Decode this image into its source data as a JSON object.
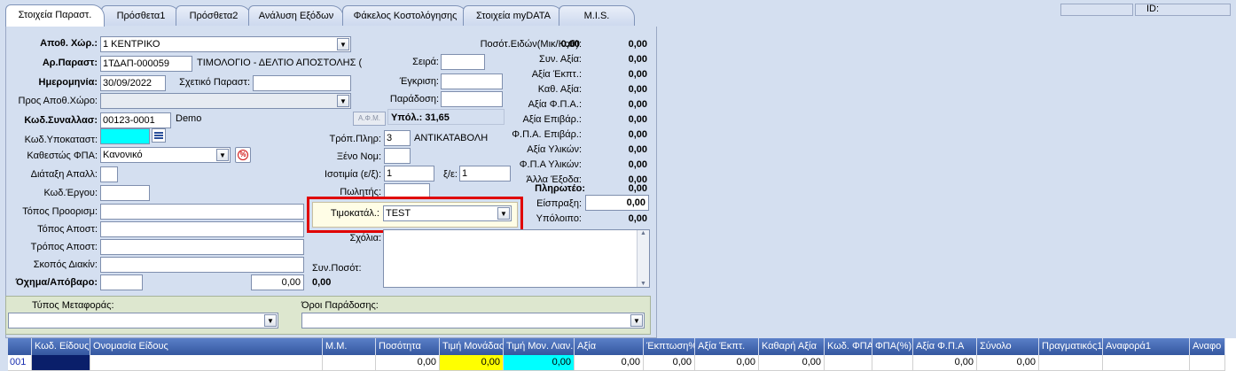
{
  "tabs": [
    "Στοιχεία Παραστ.",
    "Πρόσθετα1",
    "Πρόσθετα2",
    "Ανάλυση Εξόδων",
    "Φάκελος Κοστολόγησης",
    "Στοιχεία myDATA",
    "M.I.S."
  ],
  "top_id_label": "ID:",
  "form": {
    "warehouse_label": "Αποθ. Χώρ.:",
    "warehouse_value": "1 ΚΕΝΤΡΙΚΟ",
    "doc_no_label": "Αρ.Παραστ:",
    "doc_no_value": "1ΤΔΑΠ-000059",
    "doc_type_text": "ΤΙΜΟΛΟΓΙΟ - ΔΕΛΤΙΟ ΑΠΟΣΤΟΛΗΣ (ΕΠ. ΠΙΣΤΩ",
    "date_label": "Ημερομηνία:",
    "date_value": "30/09/2022",
    "related_doc_label": "Σχετικό Παραστ:",
    "to_warehouse_label": "Προς Αποθ.Χώρο:",
    "trader_code_label": "Κωδ.Συναλλασ:",
    "trader_code_value": "00123-0001",
    "trader_name": "Demo",
    "afm_button": "Α.Φ.Μ.",
    "balance_text": "Υπόλ.: 31,65",
    "branch_code_label": "Κωδ.Υποκαταστ:",
    "vat_status_label": "Καθεστώς ΦΠΑ:",
    "vat_status_value": "Κανονικό",
    "percent_symbol": "%",
    "disposal_label": "Διάταξη Απαλλ:",
    "project_code_label": "Κωδ.Έργου:",
    "destination_label": "Τόπος Προορισμ:",
    "dispatch_place_label": "Τόπος Αποστ:",
    "dispatch_method_label": "Τρόπος Αποστ:",
    "transport_purpose_label": "Σκοπός Διακίν:",
    "vehicle_label": "Όχημα/Απόβαρο:",
    "vehicle_weight": "0,00",
    "series_label": "Σειρά:",
    "approval_label": "Έγκριση:",
    "delivery_label": "Παράδοση:",
    "payment_method_label": "Τρόπ.Πληρ:",
    "payment_method_code": "3",
    "payment_method_name": "ΑΝΤΙΚΑΤΑΒΟΛΗ",
    "foreign_currency_label": "Ξένο Νομ:",
    "parity_label": "Ισοτιμία (ε/ξ):",
    "parity_value": "1",
    "parity2_label": "ξ/ε:",
    "parity2_value": "1",
    "seller_label": "Πωλητής:",
    "pricelist_label": "Τιμοκατάλ.:",
    "pricelist_value": "TEST",
    "comments_label": "Σχόλια:",
    "total_qty_label": "Συν.Ποσότ:",
    "total_qty_value": "0,00",
    "transport_type_label": "Τύπος Μεταφοράς:",
    "delivery_terms_label": "Όροι Παράδοσης:"
  },
  "totals": [
    {
      "label": "Ποσότ.Ειδών(Μικ/Καθ):",
      "v1": "0,00",
      "v2": "0,00"
    },
    {
      "label": "Συν. Αξία:",
      "v2": "0,00"
    },
    {
      "label": "Αξία Έκπτ.:",
      "v2": "0,00"
    },
    {
      "label": "Καθ. Αξία:",
      "v2": "0,00"
    },
    {
      "label": "Αξία Φ.Π.Α.:",
      "v2": "0,00"
    },
    {
      "label": "Αξία Επιβάρ.:",
      "v2": "0,00"
    },
    {
      "label": "Φ.Π.Α. Επιβάρ.:",
      "v2": "0,00"
    },
    {
      "label": "Αξία Υλικών:",
      "v2": "0,00"
    },
    {
      "label": "Φ.Π.Α Υλικών:",
      "v2": "0,00"
    },
    {
      "label": "Άλλα Έξοδα:",
      "v2": "0,00"
    }
  ],
  "payable_label": "Πληρωτέο:",
  "payable_value": "0,00",
  "collection_label": "Είσπραξη:",
  "collection_value": "0,00",
  "remainder_label": "Υπόλοιπο:",
  "remainder_value": "0,00",
  "grid": {
    "headers": [
      "Κωδ. Είδους",
      "Ονομασία Είδους",
      "Μ.Μ.",
      "Ποσότητα",
      "Τιμή Μονάδας",
      "Τιμή Μον. Λιαν.",
      "Αξία",
      "Έκπτωση%",
      "Αξία Έκπτ.",
      "Καθαρή Αξία",
      "Κωδ. ΦΠΑ",
      "ΦΠΑ(%)",
      "Αξία Φ.Π.Α",
      "Σύνολο",
      "Πραγματικός1",
      "Αναφορά1",
      "Αναφο"
    ],
    "row_no": "001",
    "row": [
      "",
      "",
      "",
      "0,00",
      "0,00",
      "0,00",
      "0,00",
      "0,00",
      "0,00",
      "0,00",
      "",
      "",
      "0,00",
      "0,00",
      "",
      "",
      ""
    ]
  },
  "colors": {
    "highlight_yellow": "#ffff00",
    "highlight_cyan": "#00ffff",
    "red_box": "#e00000"
  }
}
